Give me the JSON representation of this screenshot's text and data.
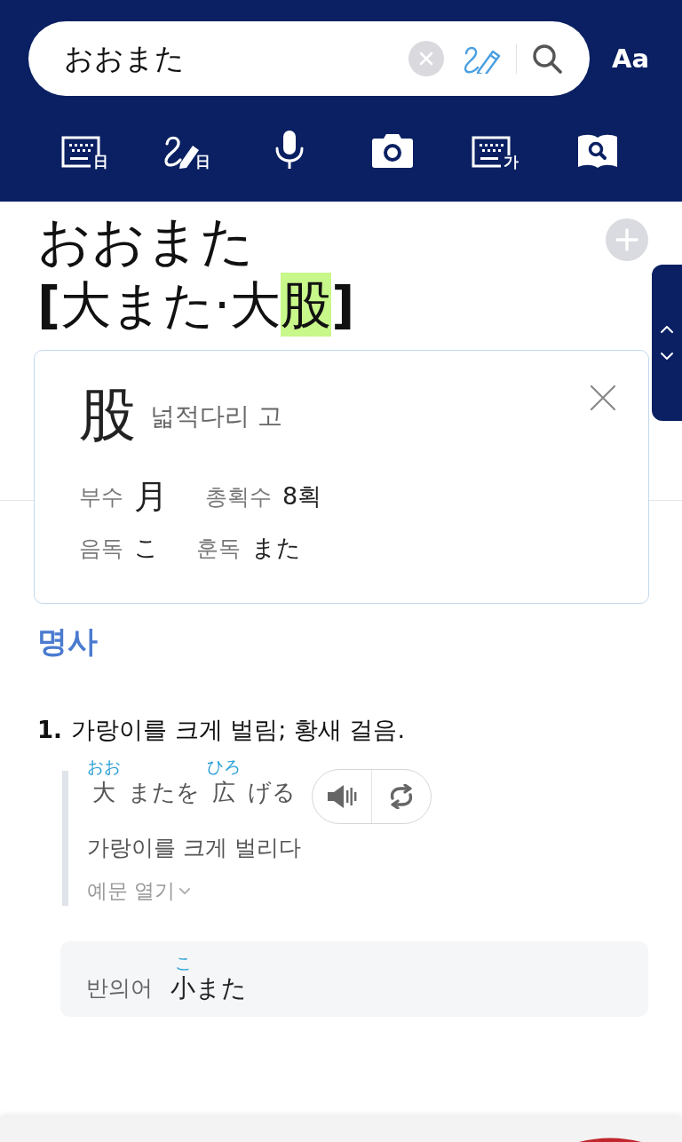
{
  "search": {
    "value": "おおまた"
  },
  "font_button": "Aa",
  "input_tools": [
    {
      "kind": "keyboard",
      "badge": "日"
    },
    {
      "kind": "handwriting",
      "badge": "日"
    },
    {
      "kind": "voice"
    },
    {
      "kind": "camera"
    },
    {
      "kind": "keyboard",
      "badge": "가"
    },
    {
      "kind": "dictionary"
    }
  ],
  "entry": {
    "reading": "おおまた",
    "kanji_parts": [
      {
        "text": "**[**大また·大",
        "highlighted": false
      },
      {
        "text": "股",
        "highlighted": true
      },
      {
        "text": "**]**",
        "highlighted": false
      }
    ]
  },
  "kanji_popup": {
    "character": "股",
    "meaning": "넓적다리 고",
    "rows": [
      [
        {
          "kind": "radical",
          "label": "부수",
          "value": "月"
        },
        {
          "kind": "plain",
          "label": "총획수",
          "value": "8획"
        }
      ],
      [
        {
          "kind": "plain",
          "label": "음독",
          "value": "こ"
        },
        {
          "kind": "plain",
          "label": "훈독",
          "value": "また"
        }
      ]
    ]
  },
  "part_of_speech": "명사",
  "senses": [
    {
      "number": "1.",
      "definition": "가랑이를 크게 벌림; 황새 걸음.",
      "examples": [
        {
          "segments": [
            {
              "text": "大",
              "ruby": "おお"
            },
            {
              "text": "またを"
            },
            {
              "text": "広",
              "ruby": "ひろ"
            },
            {
              "text": "げる"
            }
          ],
          "translation": "가랑이를 크게 벌리다"
        }
      ],
      "more_examples": {
        "label": "예문 열기",
        "expanded": false
      }
    }
  ],
  "antonym": {
    "label": "반의어",
    "segments": [
      {
        "text": "小",
        "ruby": "こ"
      },
      {
        "text": "また"
      }
    ]
  }
}
